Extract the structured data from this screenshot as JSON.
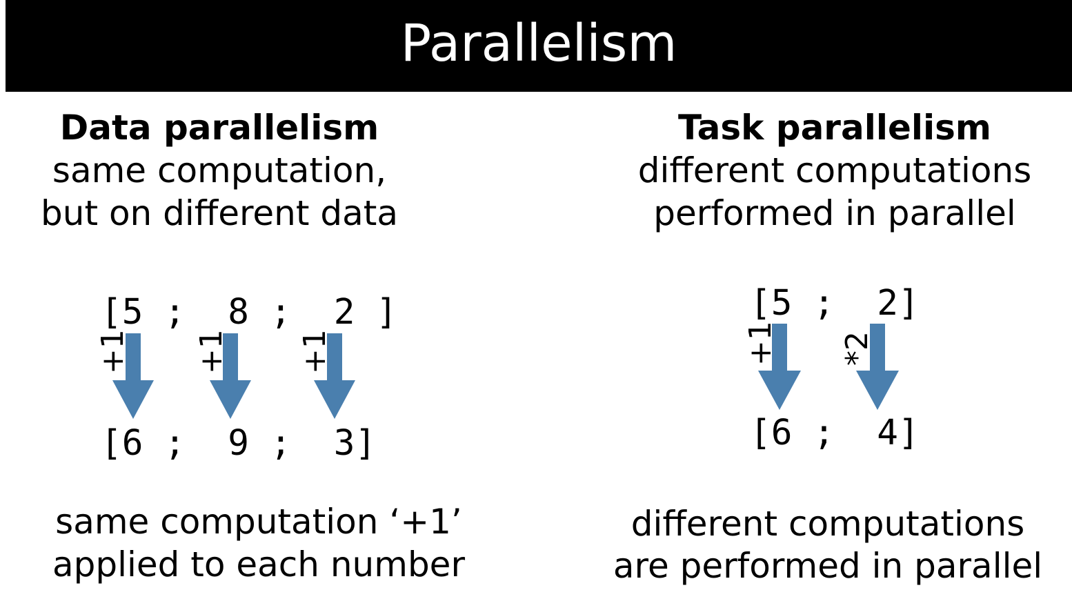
{
  "title": "Parallelism",
  "colors": {
    "title_bg": "#000000",
    "title_text": "#ffffff",
    "arrow": "#4a7fae"
  },
  "data_parallelism": {
    "heading": "Data parallelism",
    "desc_line1": "same computation,",
    "desc_line2": "but on different data",
    "input": "[5 ;  8 ;  2 ]",
    "output": "[6 ;  9 ;  3]",
    "operations": [
      "+1",
      "+1",
      "+1"
    ],
    "caption_line1": "same computation ‘+1’",
    "caption_line2": "applied to each number"
  },
  "task_parallelism": {
    "heading": "Task parallelism",
    "desc_line1": "different computations",
    "desc_line2": "performed in parallel",
    "input": "[5 ;  2]",
    "output": "[6 ;  4]",
    "operations": [
      "+1",
      "*2"
    ],
    "caption_line1": "different computations",
    "caption_line2": "are performed in parallel"
  }
}
